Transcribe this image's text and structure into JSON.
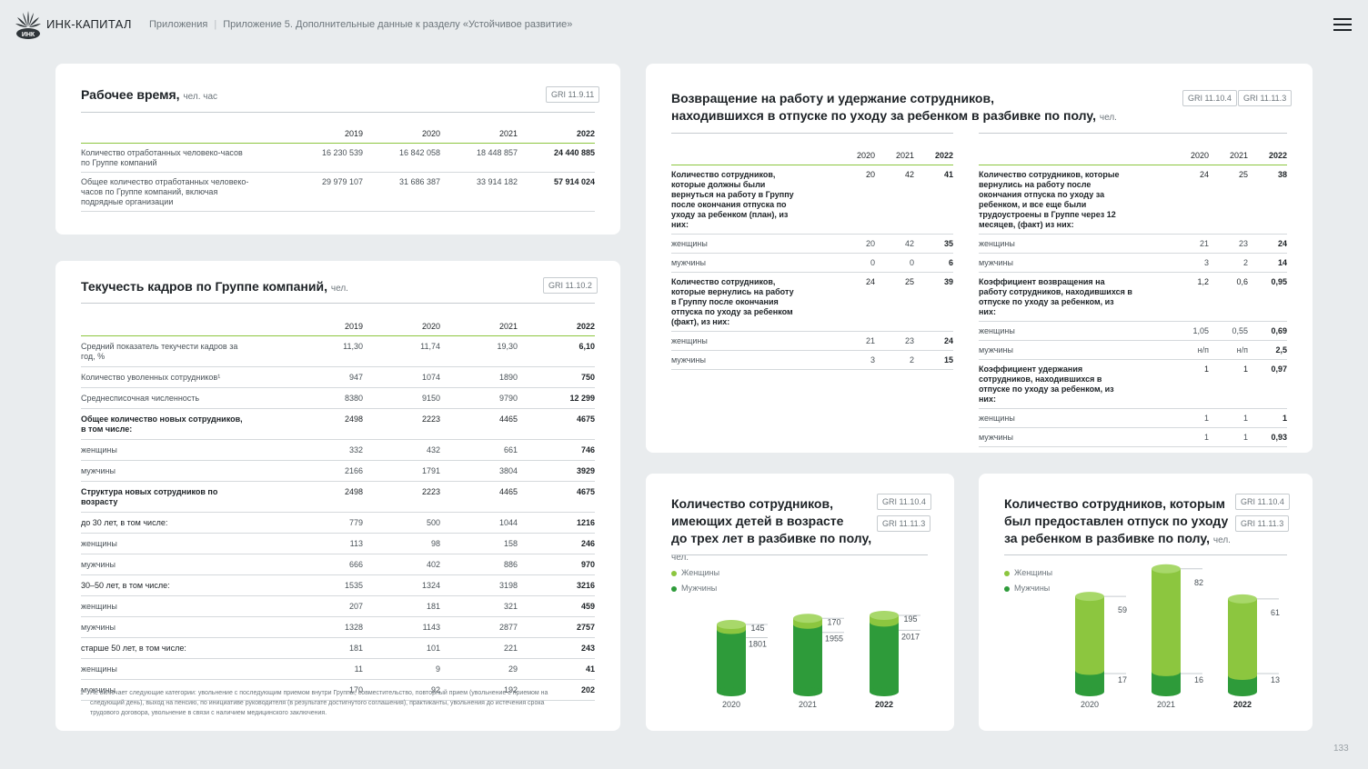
{
  "header": {
    "brand": "ИНК-КАПИТАЛ",
    "crumb1": "Приложения",
    "crumb_sep": "|",
    "crumb2": "Приложение 5. Дополнительные данные к разделу «Устойчивое развитие»"
  },
  "page_number": "133",
  "colors": {
    "light_green": "#8cc63f",
    "dark_green": "#2e9b3a",
    "accent_rule": "#8cc63f"
  },
  "work_time": {
    "title": "Рабочее время,",
    "unit": "чел. час",
    "gri": "GRI 11.9.11",
    "years": [
      "2019",
      "2020",
      "2021",
      "2022"
    ],
    "rows": [
      {
        "label": "Количество отработанных человеко-часов по Группе компаний",
        "values": [
          "16 230 539",
          "16 842 058",
          "18 448 857",
          "24 440 885"
        ]
      },
      {
        "label": "Общее количество отработанных человеко-часов по Группе компаний, включая подрядные организации",
        "values": [
          "29 979 107",
          "31 686 387",
          "33 914 182",
          "57 914 024"
        ]
      }
    ]
  },
  "turnover": {
    "title": "Текучесть кадров по Группе компаний,",
    "unit": "чел.",
    "gri": "GRI 11.10.2",
    "years": [
      "2019",
      "2020",
      "2021",
      "2022"
    ],
    "rows": [
      {
        "label": "Средний показатель текучести кадров за год, %",
        "values": [
          "11,30",
          "11,74",
          "19,30",
          "6,10"
        ],
        "bold": false
      },
      {
        "label": "Количество уволенных сотрудников¹",
        "values": [
          "947",
          "1074",
          "1890",
          "750"
        ],
        "bold": false
      },
      {
        "label": "Среднесписочная численность",
        "values": [
          "8380",
          "9150",
          "9790",
          "12 299"
        ],
        "bold": false
      },
      {
        "label": "Общее количество новых сотрудников, в том числе:",
        "values": [
          "2498",
          "2223",
          "4465",
          "4675"
        ],
        "bold": true
      },
      {
        "label": "женщины",
        "values": [
          "332",
          "432",
          "661",
          "746"
        ],
        "bold": false
      },
      {
        "label": "мужчины",
        "values": [
          "2166",
          "1791",
          "3804",
          "3929"
        ],
        "bold": false
      },
      {
        "label": "Структура новых сотрудников по возрасту",
        "values": [
          "2498",
          "2223",
          "4465",
          "4675"
        ],
        "bold": true
      },
      {
        "label": "до 30 лет, в том числе:",
        "values": [
          "779",
          "500",
          "1044",
          "1216"
        ],
        "semi": true
      },
      {
        "label": "женщины",
        "values": [
          "113",
          "98",
          "158",
          "246"
        ],
        "bold": false
      },
      {
        "label": "мужчины",
        "values": [
          "666",
          "402",
          "886",
          "970"
        ],
        "bold": false
      },
      {
        "label": "30–50 лет, в том числе:",
        "values": [
          "1535",
          "1324",
          "3198",
          "3216"
        ],
        "semi": true
      },
      {
        "label": "женщины",
        "values": [
          "207",
          "181",
          "321",
          "459"
        ],
        "bold": false
      },
      {
        "label": "мужчины",
        "values": [
          "1328",
          "1143",
          "2877",
          "2757"
        ],
        "bold": false
      },
      {
        "label": "старше 50 лет, в том числе:",
        "values": [
          "181",
          "101",
          "221",
          "243"
        ],
        "semi": true
      },
      {
        "label": "женщины",
        "values": [
          "11",
          "9",
          "29",
          "41"
        ],
        "bold": false
      },
      {
        "label": "мужчины",
        "values": [
          "170",
          "92",
          "192",
          "202"
        ],
        "bold": false
      }
    ],
    "footnote_mark": "1",
    "footnote": "Не включает следующие категории: увольнение с последующим приемом внутри Группы, совместительство, повторный прием (увольнение с приемом на следующий день), выход на пенсию, по инициативе руководителя (в результате достигнутого соглашения), практиканты, увольнения до истечения срока трудового договора, увольнение в связи с наличием медицинского заключения."
  },
  "return": {
    "title_line1": "Возвращение на работу и удержание сотрудников,",
    "title_line2": "находившихся в отпуске по уходу за ребенком в разбивке по полу,",
    "unit": "чел.",
    "gri1": "GRI 11.10.4",
    "gri2": "GRI 11.11.3",
    "years": [
      "2020",
      "2021",
      "2022"
    ],
    "left_rows": [
      {
        "label": "Количество сотрудников, которые должны были вернуться на работу в Группу после окончания отпуска по уходу за ребенком (план), из них:",
        "values": [
          "20",
          "42",
          "41"
        ],
        "bold": true
      },
      {
        "label": "женщины",
        "values": [
          "20",
          "42",
          "35"
        ],
        "bold": false
      },
      {
        "label": "мужчины",
        "values": [
          "0",
          "0",
          "6"
        ],
        "bold": false
      },
      {
        "label": "Количество сотрудников, которые вернулись на работу в Группу после окончания отпуска по уходу за ребенком (факт), из них:",
        "values": [
          "24",
          "25",
          "39"
        ],
        "bold": true
      },
      {
        "label": "женщины",
        "values": [
          "21",
          "23",
          "24"
        ],
        "bold": false
      },
      {
        "label": "мужчины",
        "values": [
          "3",
          "2",
          "15"
        ],
        "bold": false
      }
    ],
    "right_rows": [
      {
        "label": "Количество сотрудников, которые вернулись на работу после окончания отпуска по уходу за ребенком, и все еще были трудоустроены в Группе через 12 месяцев, (факт) из них:",
        "values": [
          "24",
          "25",
          "38"
        ],
        "bold": true
      },
      {
        "label": "женщины",
        "values": [
          "21",
          "23",
          "24"
        ],
        "bold": false
      },
      {
        "label": "мужчины",
        "values": [
          "3",
          "2",
          "14"
        ],
        "bold": false
      },
      {
        "label": "Коэффициент возвращения на работу сотрудников, находившихся в отпуске по уходу за ребенком, из них:",
        "values": [
          "1,2",
          "0,6",
          "0,95"
        ],
        "bold": true
      },
      {
        "label": "женщины",
        "values": [
          "1,05",
          "0,55",
          "0,69"
        ],
        "bold": false
      },
      {
        "label": "мужчины",
        "values": [
          "н/п",
          "н/п",
          "2,5"
        ],
        "bold": false
      },
      {
        "label": "Коэффициент удержания сотрудников, находившихся в отпуске по уходу за ребенком, из них:",
        "values": [
          "1",
          "1",
          "0,97"
        ],
        "bold": true
      },
      {
        "label": "женщины",
        "values": [
          "1",
          "1",
          "1"
        ],
        "bold": false
      },
      {
        "label": "мужчины",
        "values": [
          "1",
          "1",
          "0,93"
        ],
        "bold": false
      }
    ]
  },
  "chart1": {
    "title_line1": "Количество сотрудников,",
    "title_line2": "имеющих детей в возрасте",
    "title_line3": "до трех лет в разбивке по полу,",
    "unit": "чел.",
    "gri1": "GRI 11.10.4",
    "gri2": "GRI 11.11.3",
    "legend_women": "Женщины",
    "legend_men": "Мужчины"
  },
  "chart2": {
    "title_line1": "Количество сотрудников, которым",
    "title_line2": "был предоставлен отпуск по уходу",
    "title_line3": "за ребенком в разбивке по полу,",
    "unit": "чел.",
    "gri1": "GRI 11.10.4",
    "gri2": "GRI 11.11.3",
    "legend_women": "Женщины",
    "legend_men": "Мужчины"
  },
  "chart_data": [
    {
      "type": "bar",
      "stacked": true,
      "categories": [
        "2020",
        "2021",
        "2022"
      ],
      "series": [
        {
          "name": "Мужчины",
          "values": [
            1801,
            1955,
            2017
          ],
          "color": "#2e9b3a"
        },
        {
          "name": "Женщины",
          "values": [
            145,
            170,
            195
          ],
          "color": "#8cc63f"
        }
      ],
      "labels_men": [
        "1801",
        "1955",
        "2017"
      ],
      "labels_women": [
        "145",
        "170",
        "195"
      ]
    },
    {
      "type": "bar",
      "stacked": true,
      "categories": [
        "2020",
        "2021",
        "2022"
      ],
      "series": [
        {
          "name": "Мужчины",
          "values": [
            17,
            16,
            13
          ],
          "color": "#2e9b3a"
        },
        {
          "name": "Женщины",
          "values": [
            59,
            82,
            61
          ],
          "color": "#8cc63f"
        }
      ],
      "labels_men": [
        "17",
        "16",
        "13"
      ],
      "labels_women": [
        "59",
        "82",
        "61"
      ]
    }
  ]
}
